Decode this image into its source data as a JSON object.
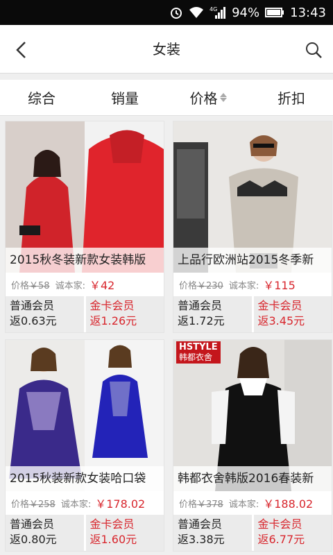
{
  "status": {
    "battery": "94%",
    "time": "13:43",
    "network": "4G"
  },
  "header": {
    "title": "女装"
  },
  "sort": {
    "items": [
      "综合",
      "销量",
      "价格",
      "折扣"
    ]
  },
  "products": [
    {
      "caption": "2015秋冬装新款女装韩版",
      "price_label": "价格",
      "old_price": "￥58",
      "cost_label": "诚本家:",
      "price": "￥42",
      "normal_member": "普通会员",
      "normal_rebate": "返0.63元",
      "gold_member": "金卡会员",
      "gold_rebate": "返1.26元"
    },
    {
      "caption": "上品行欧洲站2015冬季新",
      "price_label": "价格",
      "old_price": "￥230",
      "cost_label": "诚本家:",
      "price": "￥115",
      "normal_member": "普通会员",
      "normal_rebate": "返1.72元",
      "gold_member": "金卡会员",
      "gold_rebate": "返3.45元"
    },
    {
      "caption": "2015秋装新款女装哈口袋",
      "price_label": "价格",
      "old_price": "￥258",
      "cost_label": "诚本家:",
      "price": "￥178.02",
      "normal_member": "普通会员",
      "normal_rebate": "返0.80元",
      "gold_member": "金卡会员",
      "gold_rebate": "返1.60元"
    },
    {
      "caption": "韩都衣舍韩版2016春装新",
      "price_label": "价格",
      "old_price": "￥378",
      "cost_label": "诚本家:",
      "price": "￥188.02",
      "normal_member": "普通会员",
      "normal_rebate": "返3.38元",
      "gold_member": "金卡会员",
      "gold_rebate": "返6.77元",
      "badge_line1": "HSTYLE",
      "badge_line2": "韩都衣舍"
    }
  ]
}
